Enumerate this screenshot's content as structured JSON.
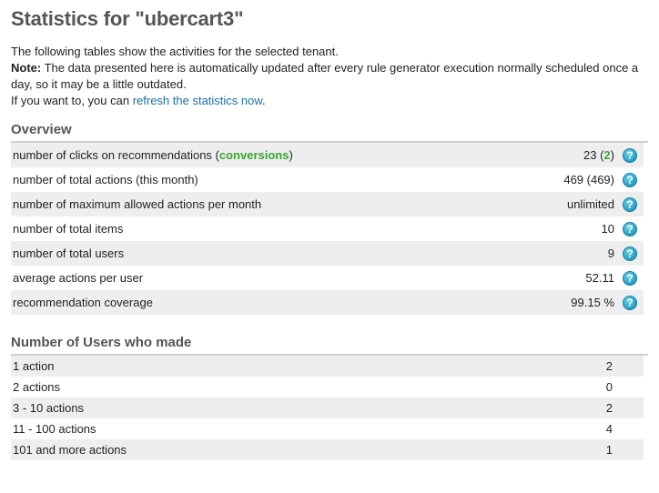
{
  "title": "Statistics for \"ubercart3\"",
  "intro": {
    "line1": "The following tables show the activities for the selected tenant.",
    "note_label": "Note:",
    "note_text": " The data presented here is automatically updated after every rule generator execution normally scheduled once a day, so it may be a little outdated.",
    "refresh_prefix": "If you want to, you can ",
    "refresh_link": "refresh the statistics now",
    "refresh_suffix": "."
  },
  "overview": {
    "heading": "Overview",
    "rows": [
      {
        "label_pre": "number of clicks on recommendations (",
        "label_link": "conversions",
        "label_post": ")",
        "value_pre": "23 (",
        "value_link": "2",
        "value_post": ")",
        "help": "?"
      },
      {
        "label": "number of total actions (this month)",
        "value": "469 (469)",
        "help": "?"
      },
      {
        "label": "number of maximum allowed actions per month",
        "value": "unlimited",
        "help": "?"
      },
      {
        "label": "number of total items",
        "value": "10",
        "help": "?"
      },
      {
        "label": "number of total users",
        "value": "9",
        "help": "?"
      },
      {
        "label": "average actions per user",
        "value": "52.11",
        "help": "?"
      },
      {
        "label": "recommendation coverage",
        "value": "99.15 %",
        "help": "?"
      }
    ]
  },
  "users": {
    "heading": "Number of Users who made",
    "rows": [
      {
        "label": "1 action",
        "value": "2"
      },
      {
        "label": "2 actions",
        "value": "0"
      },
      {
        "label": "3 - 10 actions",
        "value": "2"
      },
      {
        "label": "11 - 100 actions",
        "value": "4"
      },
      {
        "label": "101 and more actions",
        "value": "1"
      }
    ]
  }
}
